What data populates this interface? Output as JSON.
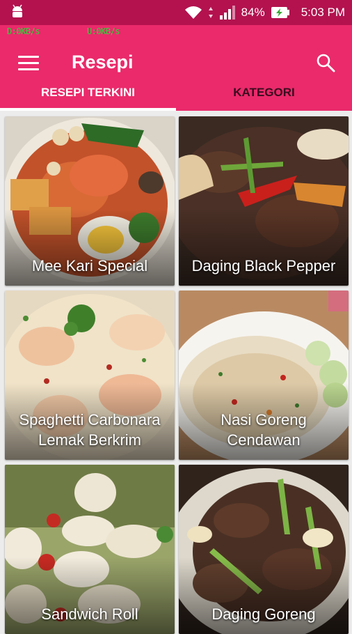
{
  "status_bar": {
    "battery": "84%",
    "time": "5:03 PM",
    "net_speed_left": "D:0KB/s",
    "net_speed_right": "U:0KB/s",
    "color": "#b3124f"
  },
  "app_bar": {
    "title": "Resepi",
    "color": "#ea2a6b",
    "menu_icon": "hamburger-menu-icon",
    "search_icon": "search-icon"
  },
  "tabs": [
    {
      "label": "RESEPI TERKINI",
      "active": true
    },
    {
      "label": "KATEGORI",
      "active": false
    }
  ],
  "recipes": [
    {
      "label": "Mee Kari Special"
    },
    {
      "label": "Daging Black Pepper"
    },
    {
      "label": "Spaghetti Carbonara Lemak Berkrim"
    },
    {
      "label": "Nasi Goreng Cendawan"
    },
    {
      "label": "Sandwich Roll"
    },
    {
      "label": "Daging Goreng"
    }
  ]
}
